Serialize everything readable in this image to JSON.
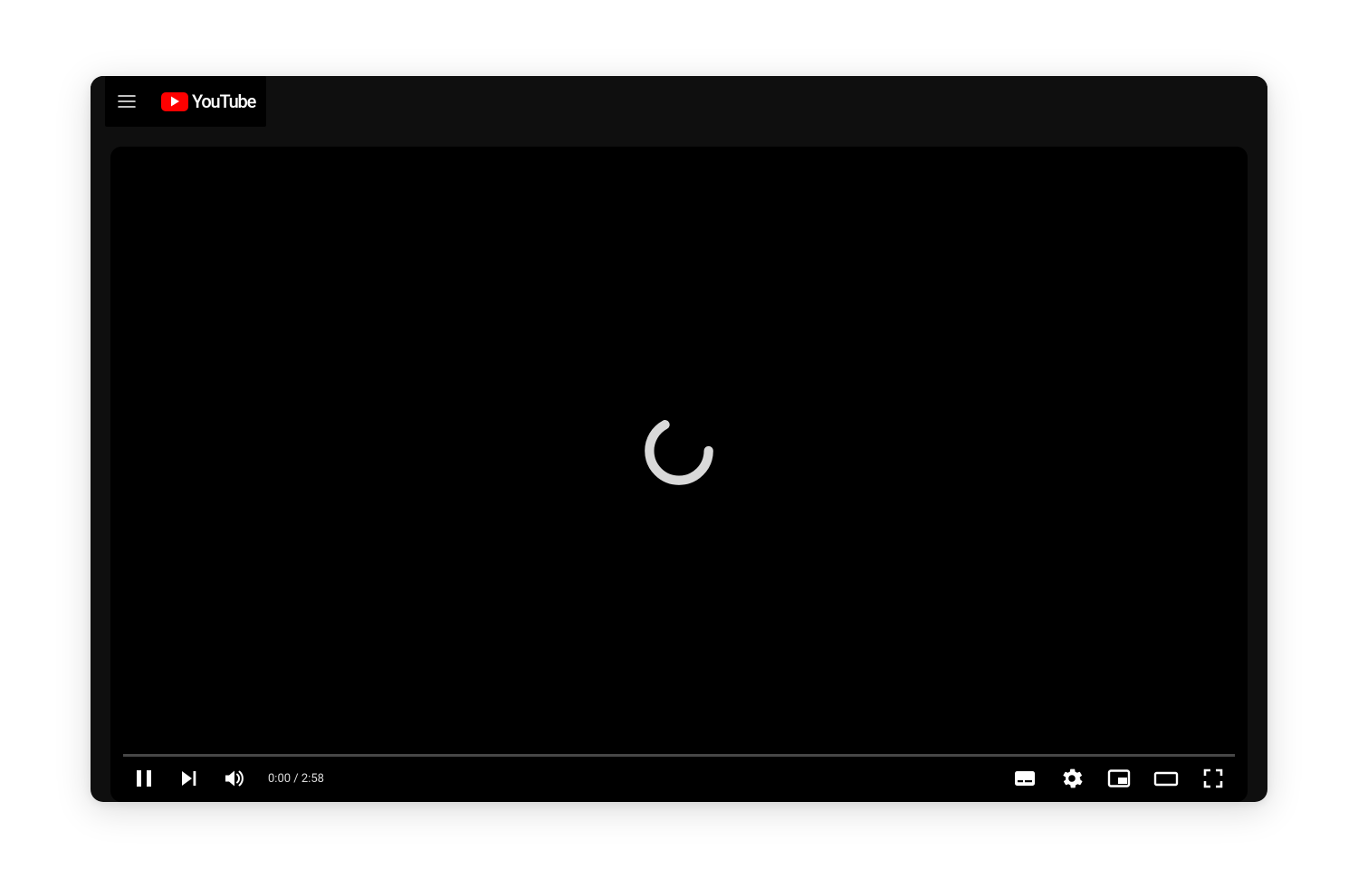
{
  "header": {
    "brand_text": "YouTube"
  },
  "player": {
    "time_display": "0:00 / 2:58",
    "current_time": "0:00",
    "duration": "2:58"
  },
  "colors": {
    "brand_red": "#ff0000",
    "bg_dark": "#0f0f0f"
  }
}
